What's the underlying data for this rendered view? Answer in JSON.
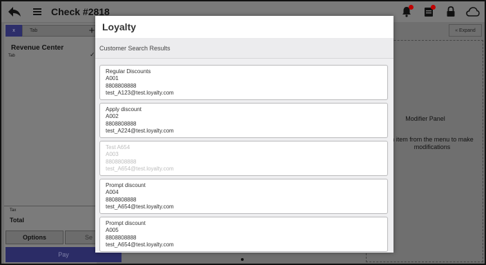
{
  "topbar": {
    "title": "Check #2818",
    "icons": [
      "back-arrow-icon",
      "hamburger-menu-icon",
      "bell-icon",
      "clipboard-icon",
      "lock-icon",
      "cloud-icon"
    ]
  },
  "left_panel": {
    "tab_x": "x",
    "tab_label": "Tab",
    "add": "+",
    "revenue_center": "Revenue Center",
    "revenue_sub": "Tab",
    "check_mark": "✓",
    "tax": "Tax",
    "total": "Total",
    "options": "Options",
    "se": "Se",
    "pay": "Pay"
  },
  "right_panel": {
    "expand": "« Expand",
    "modifier_title": "Modifier Panel",
    "modifier_hint_1": "n item from the menu to make",
    "modifier_hint_2": "modifications"
  },
  "modal": {
    "title": "Loyalty",
    "subtitle": "Customer Search Results",
    "results": [
      {
        "name": "Regular Discounts",
        "id": "A001",
        "phone": "8808808888",
        "email": "test_A123@test.loyalty.com",
        "disabled": false
      },
      {
        "name": "Apply discount",
        "id": "A002",
        "phone": "8808808888",
        "email": "test_A224@test.loyalty.com",
        "disabled": false
      },
      {
        "name": "Test A654",
        "id": "A003",
        "phone": "8808808888",
        "email": "test_A654@test.loyalty.com",
        "disabled": true
      },
      {
        "name": "Prompt discount",
        "id": "A004",
        "phone": "8808808888",
        "email": "test_A654@test.loyalty.com",
        "disabled": false
      },
      {
        "name": "Prompt discount",
        "id": "A005",
        "phone": "8808808888",
        "email": "test_A654@test.loyalty.com",
        "disabled": false
      }
    ]
  },
  "colors": {
    "overlay": "#6f6f6f",
    "pay_button": "#2b2c66",
    "badge": "#c00000",
    "modal_bg": "#efeff1"
  }
}
